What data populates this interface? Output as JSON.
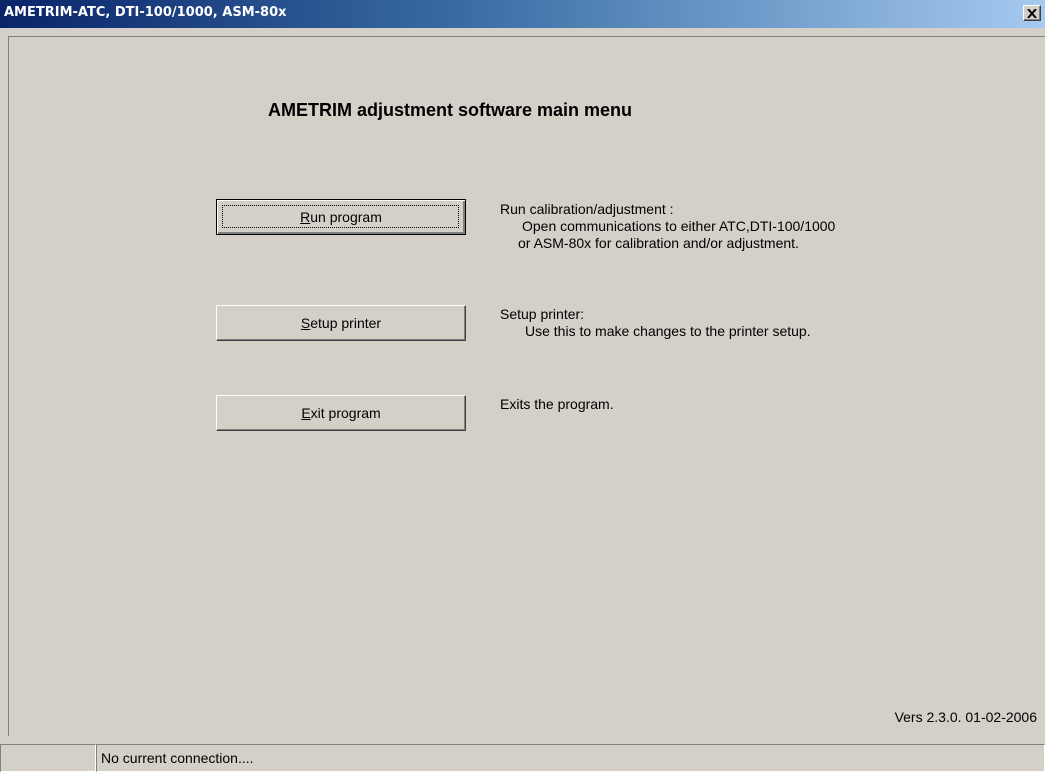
{
  "window": {
    "title": "AMETRIM-ATC, DTI-100/1000, ASM-80x",
    "close_label": "×"
  },
  "main": {
    "heading": "AMETRIM adjustment software main menu",
    "buttons": [
      {
        "accel": "R",
        "rest": "un program"
      },
      {
        "accel": "S",
        "rest": "etup printer"
      },
      {
        "accel": "E",
        "rest": "xit program"
      }
    ],
    "descriptions": [
      {
        "title": "Run calibration/adjustment :",
        "lines": [
          "Open communications to either ATC,DTI-100/1000",
          "or ASM-80x for calibration and/or adjustment."
        ]
      },
      {
        "title": "Setup printer:",
        "lines": [
          "Use this to make changes to the printer setup."
        ]
      },
      {
        "title": "Exits the program.",
        "lines": []
      }
    ],
    "version": "Vers 2.3.0. 01-02-2006"
  },
  "statusbar": {
    "pane1": "",
    "pane2": "No current connection...."
  }
}
